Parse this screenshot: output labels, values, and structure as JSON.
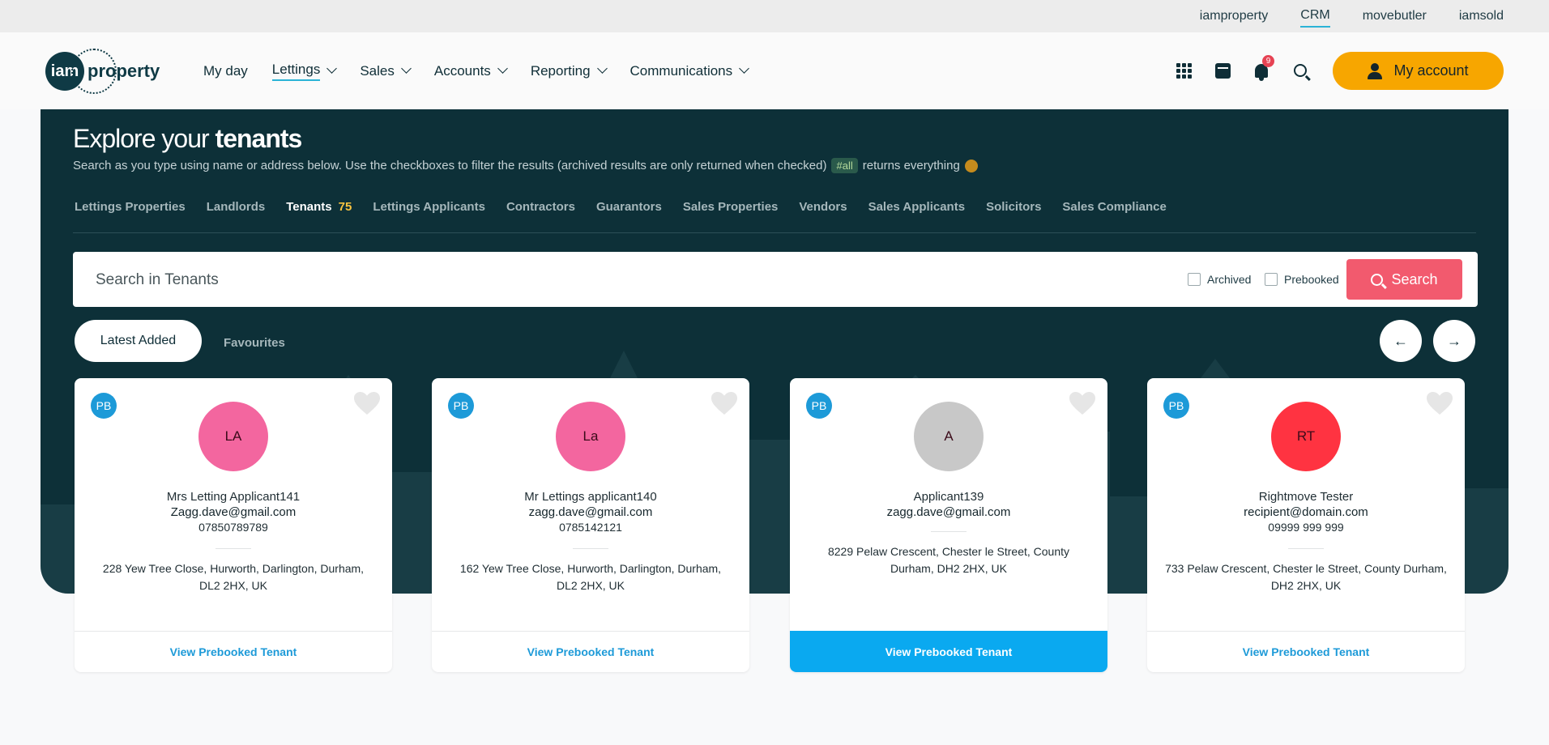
{
  "top_links": [
    "iamproperty",
    "CRM",
    "movebutler",
    "iamsold"
  ],
  "top_links_active": "CRM",
  "logo": {
    "mark": "iam",
    "text": "property"
  },
  "nav": [
    {
      "label": "My day"
    },
    {
      "label": "Lettings"
    },
    {
      "label": "Sales"
    },
    {
      "label": "Accounts"
    },
    {
      "label": "Reporting"
    },
    {
      "label": "Communications"
    }
  ],
  "header_icons": [
    "apps-grid-icon",
    "calendar-icon",
    "bell-icon",
    "search-icon"
  ],
  "notifications_count": "9",
  "account_label": "My account",
  "hero": {
    "title_light": "Explore your ",
    "title_bold": "tenants",
    "subtitle_before": "Search as you type using name or address below. Use the checkboxes to filter the results (archived results are only returned when checked)",
    "subtitle_tag": "#all",
    "subtitle_after": "returns everything"
  },
  "tabs": [
    {
      "label": "Lettings Properties"
    },
    {
      "label": "Landlords"
    },
    {
      "label": "Tenants",
      "count": "75"
    },
    {
      "label": "Lettings Applicants"
    },
    {
      "label": "Contractors"
    },
    {
      "label": "Guarantors"
    },
    {
      "label": "Sales Properties"
    },
    {
      "label": "Vendors"
    },
    {
      "label": "Sales Applicants"
    },
    {
      "label": "Solicitors"
    },
    {
      "label": "Sales Compliance"
    }
  ],
  "search": {
    "placeholder": "Search in Tenants",
    "value": "",
    "archived_label": "Archived",
    "prebooked_label": "Prebooked",
    "button_label": "Search"
  },
  "segments": {
    "latest": "Latest Added",
    "favourites": "Favourites"
  },
  "pager": {
    "prev": "←",
    "next": "→"
  },
  "cards": [
    {
      "badge": "PB",
      "initials": "LA",
      "avatar_color": "#f3669f",
      "name": "Mrs Letting Applicant141",
      "email": "Zagg.dave@gmail.com",
      "phone": "07850789789",
      "address": "228 Yew Tree Close, Hurworth, Darlington, Durham, DL2 2HX, UK",
      "action": "View Prebooked Tenant"
    },
    {
      "badge": "PB",
      "initials": "La",
      "avatar_color": "#f3669f",
      "name": "Mr Lettings applicant140",
      "email": "zagg.dave@gmail.com",
      "phone": "0785142121",
      "address": "162 Yew Tree Close, Hurworth, Darlington, Durham, DL2 2HX, UK",
      "action": "View Prebooked Tenant"
    },
    {
      "badge": "PB",
      "initials": "A",
      "avatar_color": "#c8c8c8",
      "name": "Applicant139",
      "email": "zagg.dave@gmail.com",
      "phone": "",
      "address": "8229 Pelaw Crescent, Chester le Street, County Durham, DH2 2HX, UK",
      "action": "View Prebooked Tenant"
    },
    {
      "badge": "PB",
      "initials": "RT",
      "avatar_color": "#ff3341",
      "name": "Rightmove Tester",
      "email": "recipient@domain.com",
      "phone": "09999 999 999",
      "address": "733 Pelaw Crescent, Chester le Street, County Durham, DH2 2HX, UK",
      "action": "View Prebooked Tenant"
    }
  ],
  "colors": {
    "brand_dark": "#0d3038",
    "accent_orange": "#f7a600",
    "search_button": "#f25a6e",
    "link_blue": "#1d9ad8"
  }
}
